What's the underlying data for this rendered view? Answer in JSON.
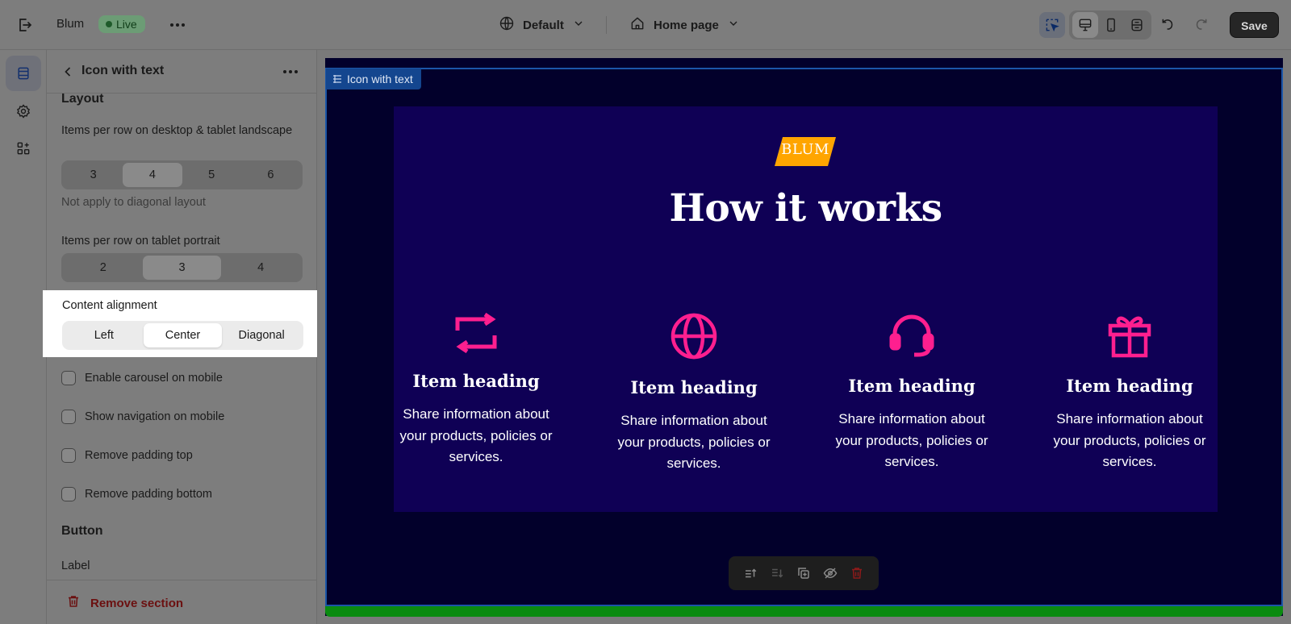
{
  "topbar": {
    "store_name": "Blum",
    "status_badge": "Live",
    "theme_label": "Default",
    "page_label": "Home page",
    "save_label": "Save",
    "icons": [
      "exit-icon",
      "more-icon",
      "globe-icon",
      "home-icon",
      "chevron-down-icon",
      "select-mode-icon",
      "desktop-icon",
      "mobile-icon",
      "fullscreen-icon",
      "undo-icon",
      "redo-icon"
    ]
  },
  "rail": {
    "icons": [
      "sections-icon",
      "settings-gear-icon",
      "apps-icon"
    ]
  },
  "panel": {
    "title": "Icon with text",
    "layout_heading": "Layout",
    "desktop_label": "Items per row on desktop & tablet landscape",
    "desktop_options": [
      "3",
      "4",
      "5",
      "6"
    ],
    "desktop_selected": "4",
    "desktop_note": "Not apply to diagonal layout",
    "tablet_label": "Items per row on tablet portrait",
    "tablet_options": [
      "2",
      "3",
      "4"
    ],
    "tablet_selected": "3",
    "alignment_label": "Content alignment",
    "alignment_options": [
      "Left",
      "Center",
      "Diagonal"
    ],
    "alignment_selected": "Center",
    "checkboxes": [
      {
        "label": "Enable carousel on mobile",
        "checked": false
      },
      {
        "label": "Show navigation on mobile",
        "checked": false
      },
      {
        "label": "Remove padding top",
        "checked": false
      },
      {
        "label": "Remove padding bottom",
        "checked": false
      }
    ],
    "button_heading": "Button",
    "label_field": "Label",
    "remove_section": "Remove section"
  },
  "preview": {
    "section_tag": "Icon with text",
    "badge": "BLUM",
    "title": "How it works",
    "items": [
      {
        "icon": "return-arrows-icon",
        "heading": "Item heading",
        "text": "Share information about your products, policies or services."
      },
      {
        "icon": "globe-icon",
        "heading": "Item heading",
        "text": "Share information about your products, policies or services."
      },
      {
        "icon": "headset-icon",
        "heading": "Item heading",
        "text": "Share information about your products, policies or services."
      },
      {
        "icon": "gift-icon",
        "heading": "Item heading",
        "text": "Share information about your products, policies or services."
      }
    ],
    "floating_toolbar": [
      "move-up-icon",
      "move-down-icon",
      "duplicate-icon",
      "hide-icon",
      "delete-icon"
    ]
  },
  "colors": {
    "preview_bg": "#02002b",
    "inner_bg": "#0f0055",
    "accent_pink": "#ff1f8f",
    "badge_orange": "#ffa500",
    "selection_blue": "#1b56a8"
  }
}
